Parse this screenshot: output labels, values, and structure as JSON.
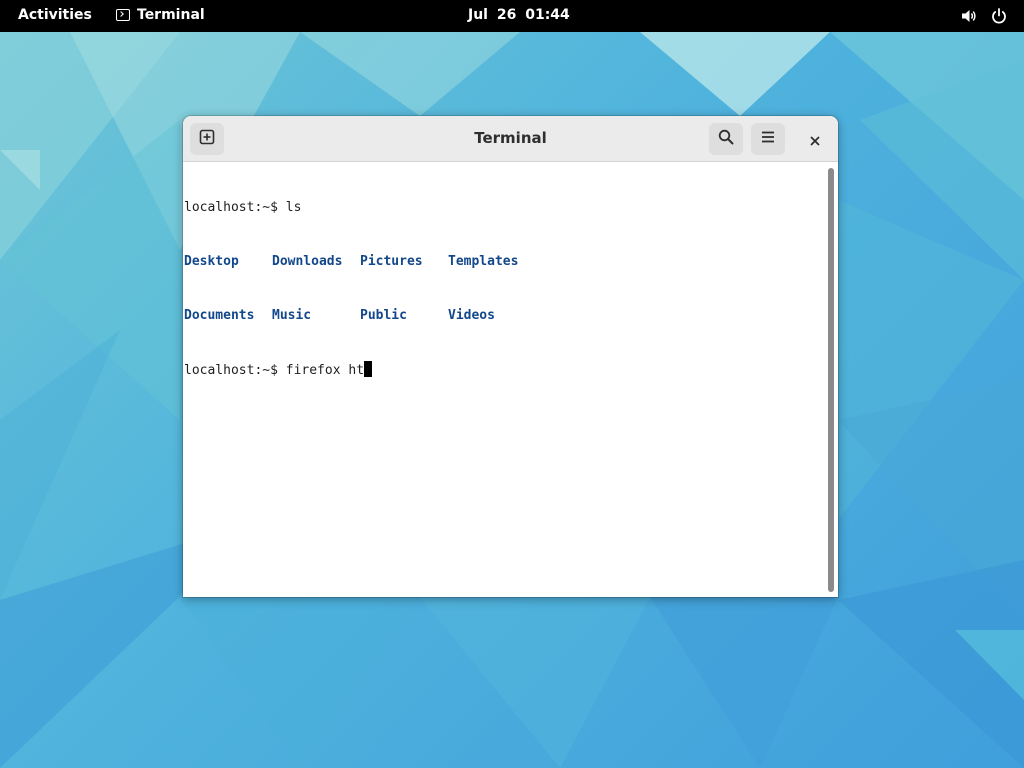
{
  "topbar": {
    "activities": "Activities",
    "app_name": "Terminal",
    "date": "Jul 26",
    "time": "01:44",
    "icons": [
      "terminal-icon",
      "volume-icon",
      "power-icon"
    ]
  },
  "window": {
    "title": "Terminal",
    "buttons": {
      "new_tab": "new-tab-icon",
      "search": "search-icon",
      "menu": "hamburger-menu-icon",
      "close": "close-icon"
    }
  },
  "terminal": {
    "prompt": "localhost:~$ ",
    "command1": "ls",
    "ls_output": [
      [
        "Desktop",
        "Downloads",
        "Pictures",
        "Templates"
      ],
      [
        "Documents",
        "Music",
        "Public",
        "Videos"
      ]
    ],
    "command2": "firefox ht",
    "colors": {
      "directory": "#12488b",
      "text": "#1f1f1f"
    }
  },
  "desktop": {
    "accent_colors": [
      "#6fc6d6",
      "#4fb3dd",
      "#3f9fdb"
    ]
  }
}
